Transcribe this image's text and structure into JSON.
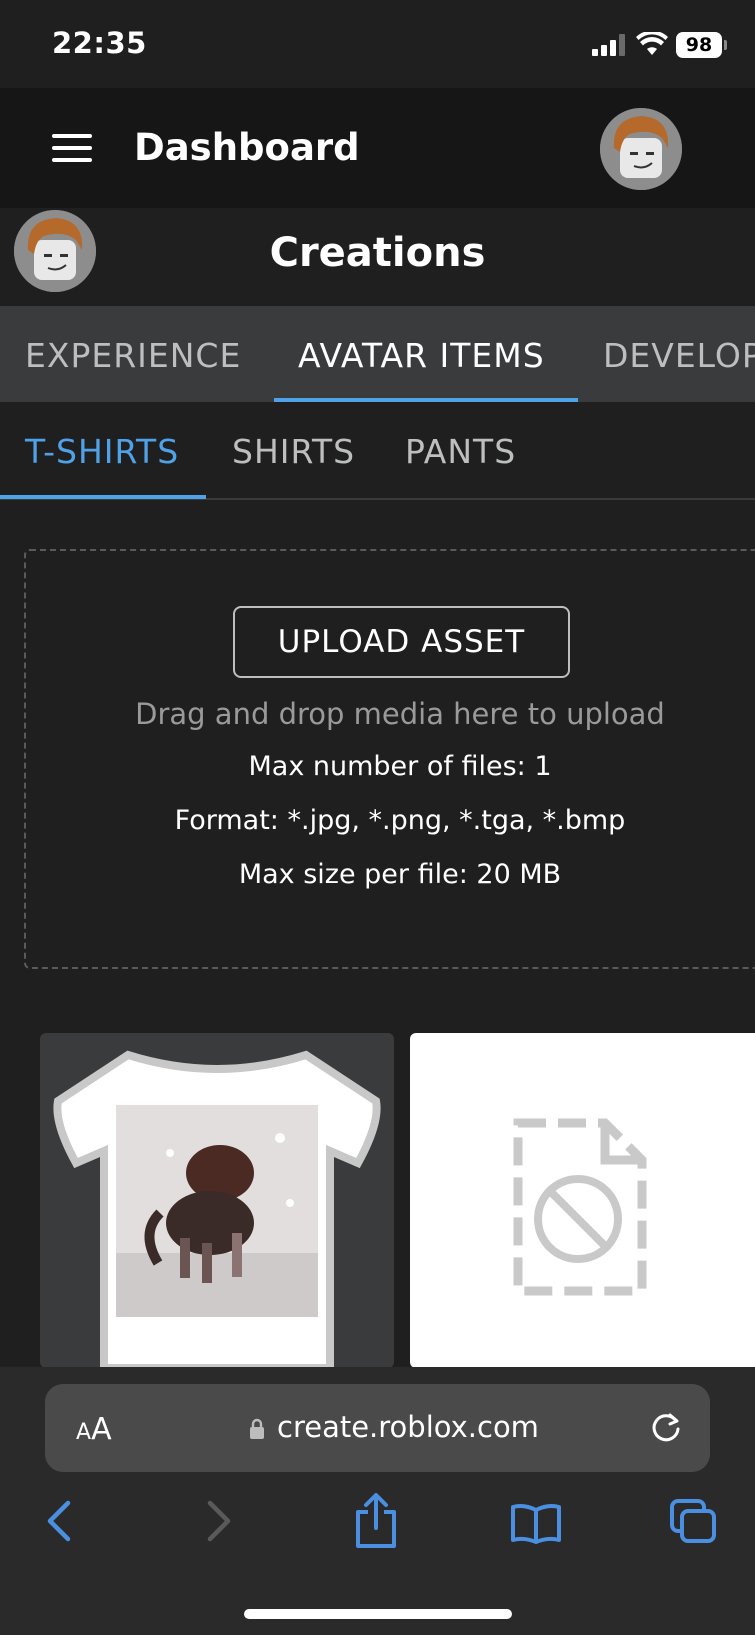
{
  "status": {
    "time": "22:35",
    "battery": "98"
  },
  "header": {
    "title": "Dashboard"
  },
  "section": {
    "title": "Creations"
  },
  "main_tabs": [
    {
      "label": "EXPERIENCE"
    },
    {
      "label": "AVATAR ITEMS"
    },
    {
      "label": "DEVELOPER ITEMS"
    }
  ],
  "sub_tabs": [
    {
      "label": "T-SHIRTS"
    },
    {
      "label": "SHIRTS"
    },
    {
      "label": "PANTS"
    }
  ],
  "upload": {
    "button_label": "UPLOAD ASSET",
    "hint": "Drag and drop media here to upload",
    "max_files": "Max number of files: 1",
    "formats": "Format: *.jpg, *.png, *.tga, *.bmp",
    "max_size": "Max size per file: 20 MB"
  },
  "browser": {
    "text_size_label_small": "A",
    "text_size_label_large": "A",
    "url": "create.roblox.com"
  },
  "colors": {
    "accent": "#4fa2e8",
    "background": "#1f1f1f",
    "tab_bar": "#393b3d"
  }
}
